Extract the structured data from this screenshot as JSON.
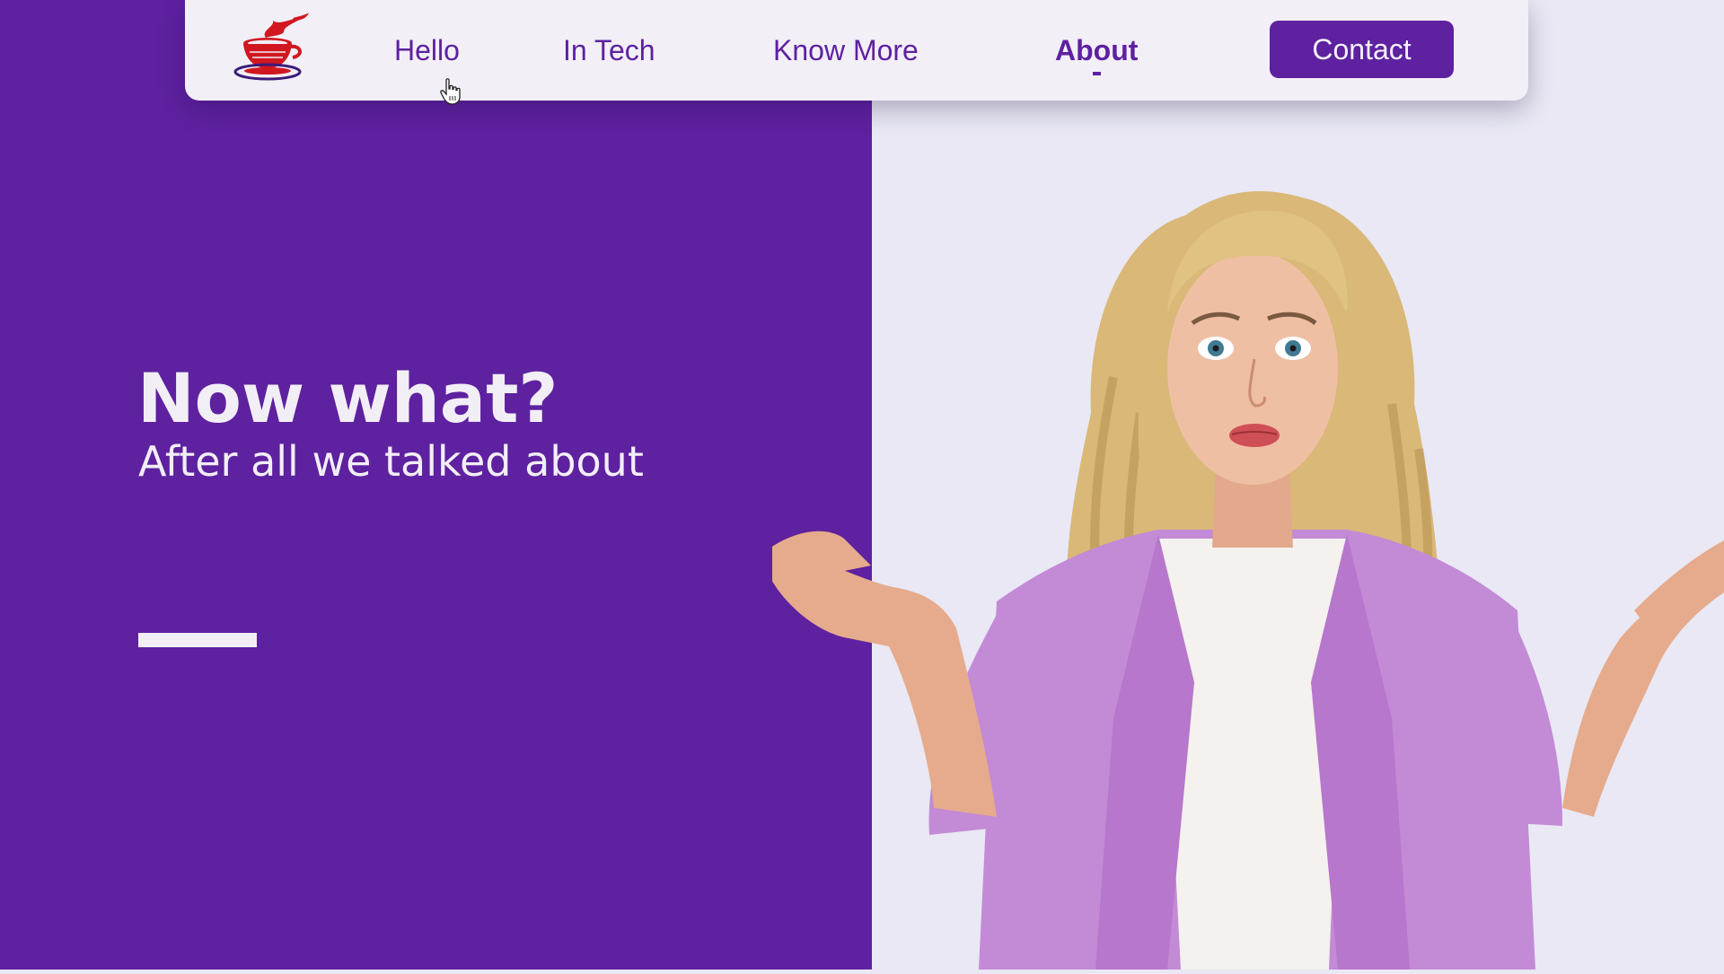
{
  "nav": {
    "logo_icon": "coffee-cup-icon",
    "links": [
      {
        "label": "Hello"
      },
      {
        "label": "In Tech"
      },
      {
        "label": "Know More"
      },
      {
        "label": "About"
      }
    ],
    "active": "About",
    "contact_label": "Contact"
  },
  "hero": {
    "title": "Now what?",
    "subtitle": "After all we talked about"
  },
  "colors": {
    "brand_purple": "#5e21a0",
    "nav_bg": "#f2eff7",
    "page_bg": "#e9e8f4",
    "hero_text": "#f2eef6",
    "logo_red": "#d1171f"
  },
  "cursor_icon": "hand-pointer-icon",
  "photo_icon": "shrugging-woman-photo"
}
